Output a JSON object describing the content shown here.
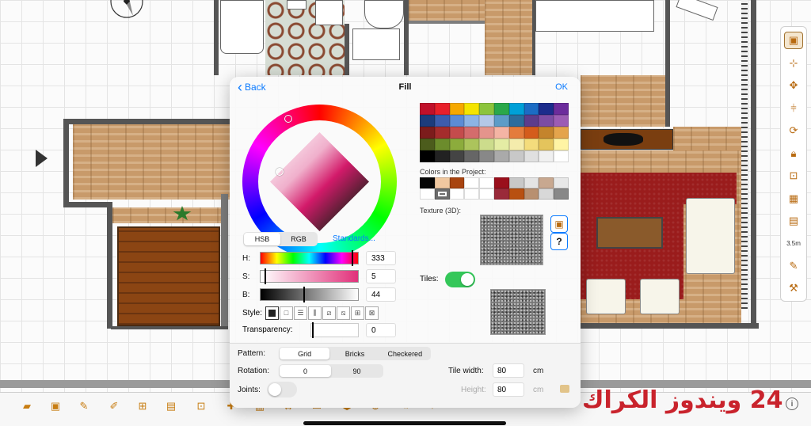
{
  "dialog": {
    "title": "Fill",
    "back_label": "Back",
    "ok_label": "OK",
    "color_model_tabs": [
      "HSB",
      "RGB"
    ],
    "active_model": "HSB",
    "standards_label": "Standards...",
    "h_label": "H:",
    "s_label": "S:",
    "b_label": "B:",
    "h_value": "333",
    "s_value": "5",
    "b_value": "44",
    "style_label": "Style:",
    "transparency_label": "Transparency:",
    "transparency_value": "0",
    "project_colors_label": "Colors in the Project:",
    "texture_label": "Texture (3D):",
    "texture_question": "?",
    "tiles_label": "Tiles:",
    "tiles_on": true,
    "pattern_label": "Pattern:",
    "pattern_options": [
      "Grid",
      "Bricks",
      "Checkered"
    ],
    "pattern_selected": "Grid",
    "rotation_label": "Rotation:",
    "rotation_options": [
      "0",
      "90"
    ],
    "rotation_selected": "0",
    "joints_label": "Joints:",
    "joints_on": false,
    "tile_width_label": "Tile width:",
    "tile_width_value": "80",
    "height_label": "Height:",
    "height_value": "80",
    "unit": "cm"
  },
  "palette": [
    "#c0102a",
    "#e8202a",
    "#f6a800",
    "#f4e400",
    "#8cc43c",
    "#2aa84a",
    "#00a0d8",
    "#1c6cc4",
    "#1c2c8c",
    "#6c2c9c",
    "#1c3c7c",
    "#3c5cac",
    "#5c8cd4",
    "#8cb4e4",
    "#b4c8e8",
    "#5c9cc8",
    "#2c6c9c",
    "#5c3c8c",
    "#7c4ca4",
    "#9c5cb4",
    "#7c1c1c",
    "#a42c2c",
    "#c44c4c",
    "#d46c6c",
    "#e4948c",
    "#f4b4a4",
    "#e47c3c",
    "#d45c1c",
    "#c4842c",
    "#e4a44c",
    "#4c5c1c",
    "#6c8c2c",
    "#8cac3c",
    "#acc45c",
    "#ccdc8c",
    "#e4eca4",
    "#f4ecac",
    "#f4dc7c",
    "#e4c45c",
    "#fff4a4",
    "#000000",
    "#222222",
    "#444444",
    "#666666",
    "#888888",
    "#aaaaaa",
    "#c8c8c8",
    "#e0e0e0",
    "#f0f0f0",
    "#ffffff"
  ],
  "project_colors": [
    "#050505",
    "#f0c8a0",
    "#a84410",
    "#ffffff",
    "#ffffff",
    "#9a0f1c",
    "#c8c8c8",
    "#e4e4e4",
    "#c8a890",
    "#e8e8e8",
    "#ffffff",
    "#6c6c6c",
    "#ffffff",
    "#ffffff",
    "#ffffff",
    "#9a2a3a",
    "#b85010",
    "#b89070",
    "#d8d8d8",
    "#888888"
  ],
  "toolbar_icons": [
    "open-folder-icon",
    "save-icon",
    "edit-pencil-icon",
    "pen-icon",
    "create-walls-icon",
    "create-room-icon",
    "create-polyline-icon",
    "add-furniture-icon",
    "add-camera-icon",
    "dimension-icon",
    "label-icon",
    "3d-view-icon",
    "virtual-visit-icon",
    "export-icon",
    "import-icon",
    "preferences-icon"
  ],
  "rail_icons": [
    "select-icon",
    "pan-icon",
    "move-icon",
    "align-icon",
    "rotate-icon",
    "lock-icon",
    "lock-alt-icon",
    "group-icon",
    "ungroup-icon",
    "dimension-length-icon",
    "paint-icon",
    "wrench-icon"
  ],
  "rail_dimension_text": "3.5m",
  "info_label": "i",
  "watermark": "24 ويندوز الكراك"
}
